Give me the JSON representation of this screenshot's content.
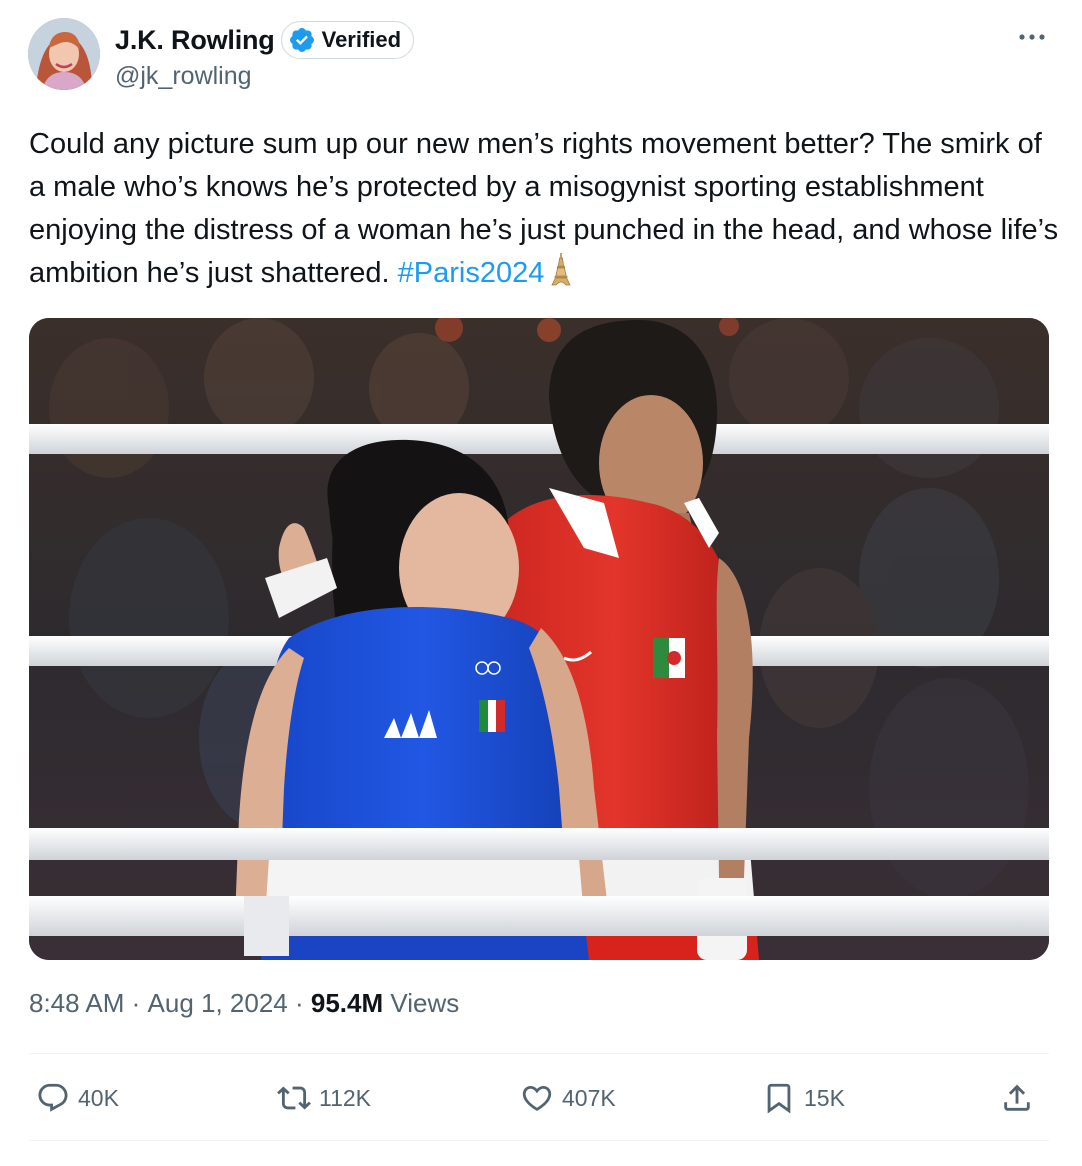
{
  "author": {
    "display_name": "J.K. Rowling",
    "verified_label": "Verified",
    "handle": "@jk_rowling",
    "avatar_icon": "avatar-photo"
  },
  "tweet": {
    "text": "Could any picture sum up our new men’s rights movement better? The smirk of a male who’s knows he’s protected by a misogynist sporting establishment enjoying the distress of a woman he’s just punched in the head, and whose life’s ambition he’s just shattered. ",
    "hashtag": "#Paris2024",
    "emoji_icon": "eiffel-tower-icon"
  },
  "meta": {
    "time": "8:48 AM",
    "separator": " · ",
    "date": "Aug 1, 2024",
    "views_count": "95.4M",
    "views_label": " Views"
  },
  "actions": {
    "reply_count": "40K",
    "repost_count": "112K",
    "like_count": "407K",
    "bookmark_count": "15K"
  },
  "colors": {
    "accent": "#1d9bf0",
    "text_primary": "#0f1419",
    "text_secondary": "#536471",
    "divider": "#eff3f4"
  }
}
